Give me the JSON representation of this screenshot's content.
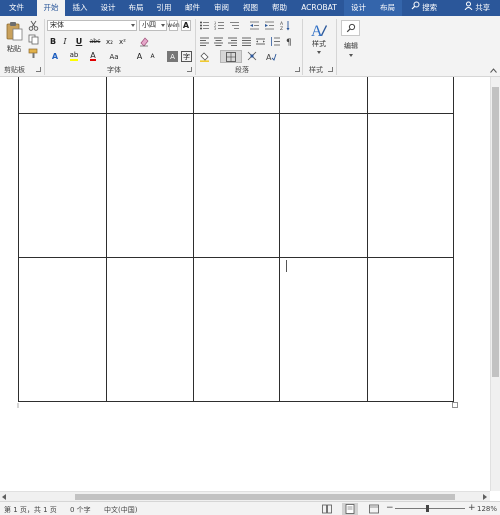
{
  "tabs": [
    {
      "label": "文件"
    },
    {
      "label": "开始"
    },
    {
      "label": "插入"
    },
    {
      "label": "设计"
    },
    {
      "label": "布局"
    },
    {
      "label": "引用"
    },
    {
      "label": "邮件"
    },
    {
      "label": "审阅"
    },
    {
      "label": "视图"
    },
    {
      "label": "帮助"
    },
    {
      "label": "ACROBAT"
    },
    {
      "label": "设计"
    },
    {
      "label": "布局"
    }
  ],
  "search_label": "搜索",
  "share_label": "共享",
  "ribbon": {
    "clipboard": {
      "label": "剪贴板",
      "paste_label": "粘贴"
    },
    "font": {
      "label": "字体",
      "font_name": "宋体",
      "font_size": "小四",
      "bold": "B",
      "italic": "I",
      "underline": "U",
      "strike": "abc",
      "subscript": "x₂",
      "superscript": "x²",
      "text_effects": "A",
      "highlight": "ab",
      "font_color": "A",
      "change_case": "Aa",
      "grow": "A",
      "shrink": "A",
      "char_border": "A"
    },
    "paragraph": {
      "label": "段落"
    },
    "styles": {
      "label": "样式",
      "button_label": "样式"
    },
    "editing": {
      "label": "编辑",
      "button_label": "编辑"
    }
  },
  "status": {
    "page": "第 1 页，共 1 页",
    "words": "0 个字",
    "language": "中文(中国)",
    "zoom": "128%"
  },
  "colors": {
    "accent": "#2b579a",
    "ribbon_bg": "#f3f3f3",
    "highlight_yellow": "#ffff00",
    "font_red": "#e00000"
  }
}
